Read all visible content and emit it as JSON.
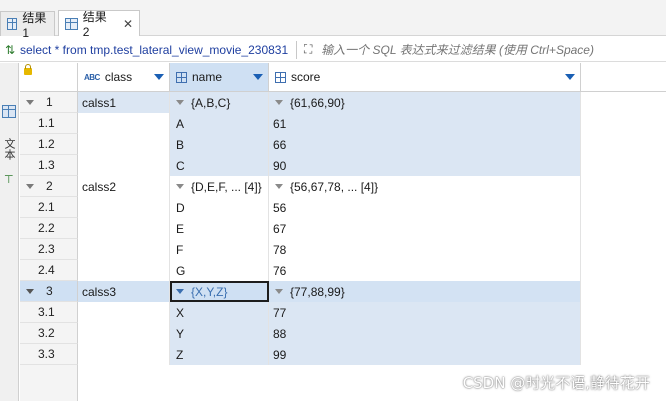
{
  "tabs": [
    {
      "label": "结果 1",
      "active": false
    },
    {
      "label": "结果 2",
      "active": true
    }
  ],
  "filter": {
    "sql": "select * from tmp.test_lateral_view_movie_230831",
    "placeholder": "输入一个 SQL 表达式来过滤结果 (使用 Ctrl+Space)"
  },
  "side_tabs": {
    "grid": "网格",
    "text": "文本"
  },
  "columns": [
    {
      "type": "ABC",
      "label": "class"
    },
    {
      "type": "grid",
      "label": "name"
    },
    {
      "type": "grid",
      "label": "score"
    }
  ],
  "rows": [
    {
      "rn": "1",
      "class": "calss1",
      "name": "{A,B,C}",
      "score": "{61,66,90}"
    },
    {
      "rn": "1.1",
      "name": "A",
      "score": "61"
    },
    {
      "rn": "1.2",
      "name": "B",
      "score": "66"
    },
    {
      "rn": "1.3",
      "name": "C",
      "score": "90"
    },
    {
      "rn": "2",
      "class": "calss2",
      "name": "{D,E,F, ... [4]}",
      "score": "{56,67,78, ... [4]}"
    },
    {
      "rn": "2.1",
      "name": "D",
      "score": "56"
    },
    {
      "rn": "2.2",
      "name": "E",
      "score": "67"
    },
    {
      "rn": "2.3",
      "name": "F",
      "score": "78"
    },
    {
      "rn": "2.4",
      "name": "G",
      "score": "76"
    },
    {
      "rn": "3",
      "class": "calss3",
      "name": "{X,Y,Z}",
      "score": "{77,88,99}"
    },
    {
      "rn": "3.1",
      "name": "X",
      "score": "77"
    },
    {
      "rn": "3.2",
      "name": "Y",
      "score": "88"
    },
    {
      "rn": "3.3",
      "name": "Z",
      "score": "99"
    }
  ],
  "watermark": "CSDN @时光不语,静待花开",
  "colors": {
    "selection": "#cfe0f3",
    "row_blue": "#dbe6f3",
    "sql_text": "#1f3fa0"
  }
}
